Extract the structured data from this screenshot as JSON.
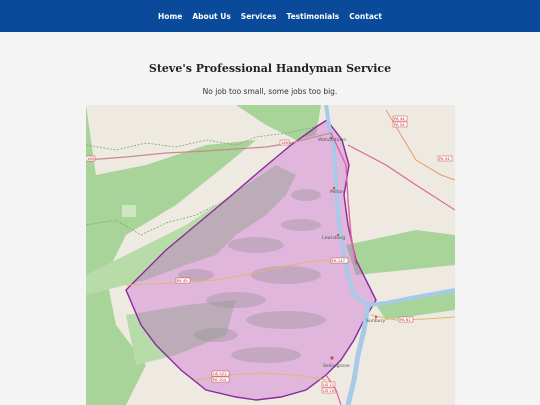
{
  "nav": {
    "items": [
      {
        "label": "Home",
        "key": "home"
      },
      {
        "label": "About Us",
        "key": "about"
      },
      {
        "label": "Services",
        "key": "services"
      },
      {
        "label": "Testimonials",
        "key": "testimonials"
      },
      {
        "label": "Contact",
        "key": "contact"
      }
    ]
  },
  "page": {
    "title": "Steve's Professional Handyman Service",
    "tagline": "No job too small, some jobs too big."
  },
  "map": {
    "towns": {
      "watsontown": "Watsontown",
      "milton": "Milton",
      "lewisburg": "Lewisburg",
      "sunbury": "Sunbury",
      "selinsgrove": "Selinsgrove"
    },
    "routes": {
      "i180": "180",
      "i180b": "180",
      "pa44": "PA 44",
      "pa54a": "PA 54",
      "pa54b": "PA 54",
      "pa147": "PA 147",
      "pa45": "PA 45",
      "pa61": "PA 61",
      "us522": "US 522",
      "pa104": "PA 104",
      "us11": "US 11",
      "us15": "US 15"
    }
  },
  "colors": {
    "nav_bg": "#0a4a9a",
    "page_bg": "#f4f4f4",
    "service_area_fill": "#c84bd6",
    "service_area_stroke": "#8b2a9b",
    "forest": "#a8d49a",
    "river": "#a9c9e8"
  }
}
